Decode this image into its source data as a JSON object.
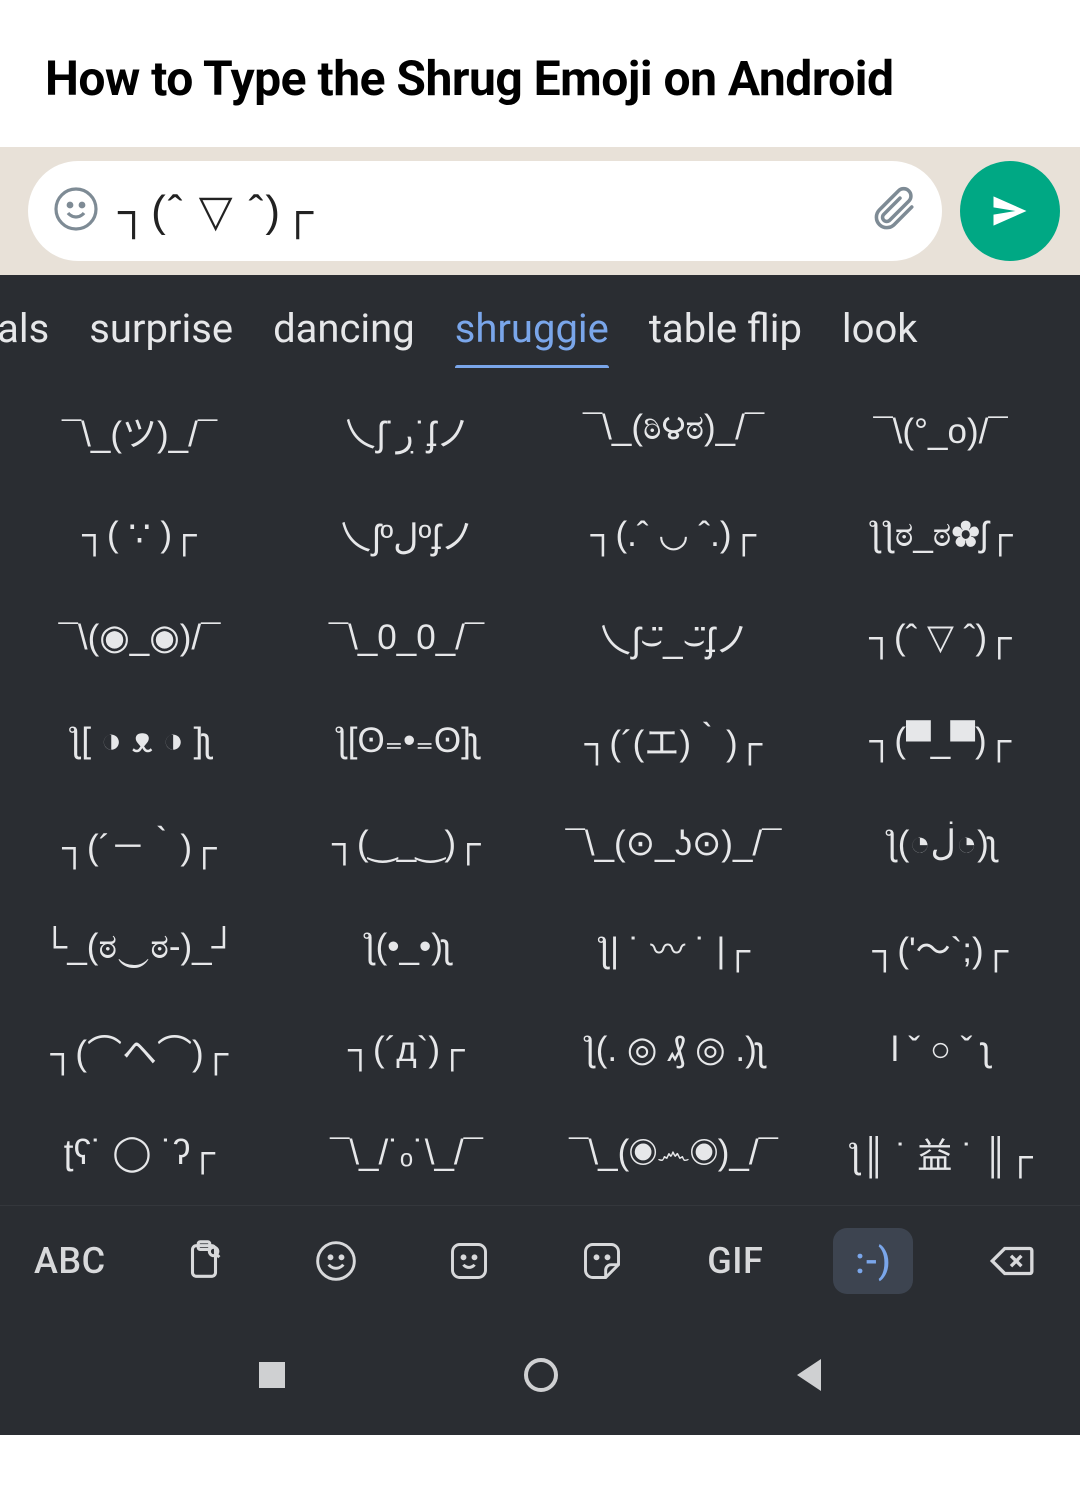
{
  "header": {
    "title": "How to Type the Shrug Emoji on Android"
  },
  "input": {
    "text": "┐(ˆ ▽ ˆ)┌"
  },
  "categories": [
    "mals",
    "surprise",
    "dancing",
    "shruggie",
    "table flip",
    "look"
  ],
  "active_category_index": 3,
  "kaomoji": [
    "¯\\_(ツ)_/¯",
    "乀ʃ˙ڔ˙ʄノ",
    "¯\\_(ಠಿ౪ಠ)_/¯",
    "¯\\(°_o)/¯",
    "┐( ∵ )┌",
    "乀ʃºلºʄノ",
    "┐(.ˆ ◡ ˆ.)┌",
    "ƪƪಠ_ಠ✿ʃ┌",
    "¯\\(◉_◉)/¯",
    "¯\\_0_0_/¯",
    "乀ʃ⌣̈_⌣̈ʄノ",
    "┐(ˆ ▽ ˆ)┌",
    "ƪ[ ◑ ᴥ ◑ ]ʅ",
    "ƪ[ʘ₌•₌ʘ]ʅ",
    "┐(´(エ)｀)┌",
    "┐(▀_▀)┌",
    "┐(´－｀)┌",
    "┐(‿_‿)┌",
    "¯\\_(⊙_ʖ⊙)_/¯",
    "ƪ(◔ڶ◔)ʅ",
    "└_(ಠ‿ಠ-)_┘",
    "ƪ(•_•)ʅ",
    "ƪ| ˙ 〰 ˙ |┌",
    "┐('～`;)┌",
    "┐(⌒ヘ⌒)┌",
    "┐(´д`)┌",
    "ƪ(. ◎ ₰ ◎ .)ʅ",
    "Ɩ ˇ ○ ˇ ʅ",
    "ʈʕ˙ ◯ ˙ʔ┌",
    "¯\\_/˙ₒ˙\\_/¯",
    "¯\\_(◉෴◉)_/¯",
    "ƪ║ ˙ 益 ˙ ║┌"
  ],
  "bottom_bar": {
    "abc": "ABC",
    "gif": "GIF",
    "emoticon": ":-)"
  }
}
